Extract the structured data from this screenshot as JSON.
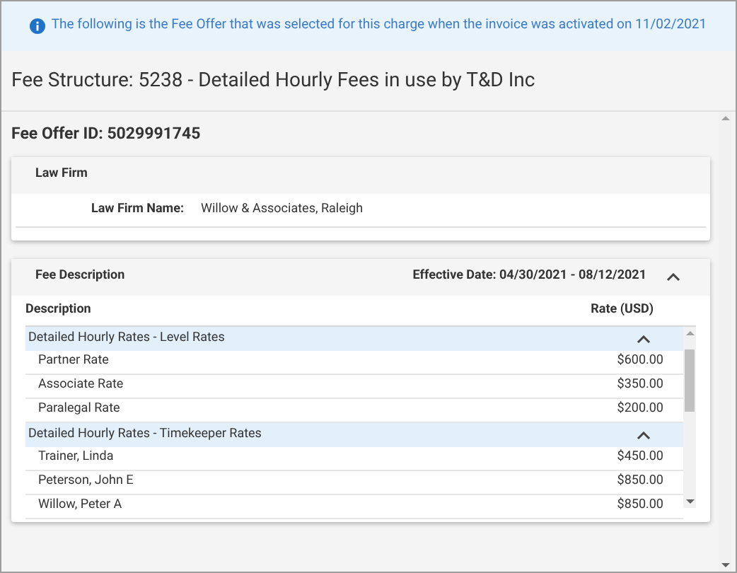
{
  "banner": {
    "text": "The following is the Fee Offer that was selected for this charge when the invoice was activated on 11/02/2021"
  },
  "title": "Fee Structure: 5238 - Detailed Hourly Fees in use by T&D Inc",
  "fee_offer_id": "Fee Offer ID: 5029991745",
  "law_firm": {
    "heading": "Law Firm",
    "label": "Law Firm Name:",
    "value": "Willow & Associates, Raleigh"
  },
  "fee_description": {
    "heading": "Fee Description",
    "effective_date": "Effective Date: 04/30/2021 - 08/12/2021",
    "expanded": true,
    "columns": [
      "Description",
      "Rate (USD)"
    ],
    "groups": [
      {
        "name": "Detailed Hourly Rates - Level Rates",
        "expanded": true,
        "rows": [
          {
            "description": "Partner Rate",
            "rate": "$600.00"
          },
          {
            "description": "Associate Rate",
            "rate": "$350.00"
          },
          {
            "description": "Paralegal Rate",
            "rate": "$200.00"
          }
        ]
      },
      {
        "name": "Detailed Hourly Rates - Timekeeper Rates",
        "expanded": true,
        "rows": [
          {
            "description": "Trainer, Linda",
            "rate": "$450.00"
          },
          {
            "description": "Peterson, John E",
            "rate": "$850.00"
          },
          {
            "description": "Willow, Peter A",
            "rate": "$850.00"
          }
        ]
      }
    ]
  }
}
